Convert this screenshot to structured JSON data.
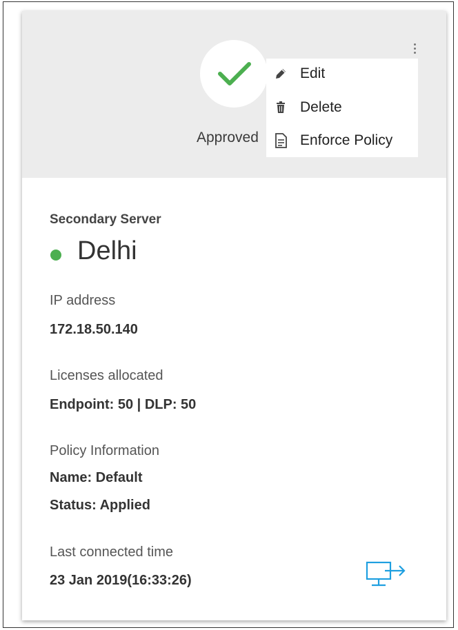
{
  "header": {
    "status_label": "Approved",
    "status_color": "#4caf50"
  },
  "menu": {
    "items": [
      {
        "label": "Edit",
        "icon": "pencil-icon"
      },
      {
        "label": "Delete",
        "icon": "trash-icon"
      },
      {
        "label": "Enforce Policy",
        "icon": "document-icon"
      }
    ]
  },
  "server": {
    "type": "Secondary Server",
    "name": "Delhi",
    "status_dot_color": "#4caf50"
  },
  "details": {
    "ip_label": "IP address",
    "ip_value": "172.18.50.140",
    "licenses_label": "Licenses allocated",
    "licenses_value": "Endpoint: 50 | DLP: 50",
    "policy_label": "Policy Information",
    "policy_name": "Name: Default",
    "policy_status": "Status: Applied",
    "last_connected_label": "Last connected time",
    "last_connected_value": "23 Jan 2019(16:33:26)"
  },
  "icons": {
    "connect": "remote-connect-icon",
    "accent": "#1e9fe0"
  }
}
